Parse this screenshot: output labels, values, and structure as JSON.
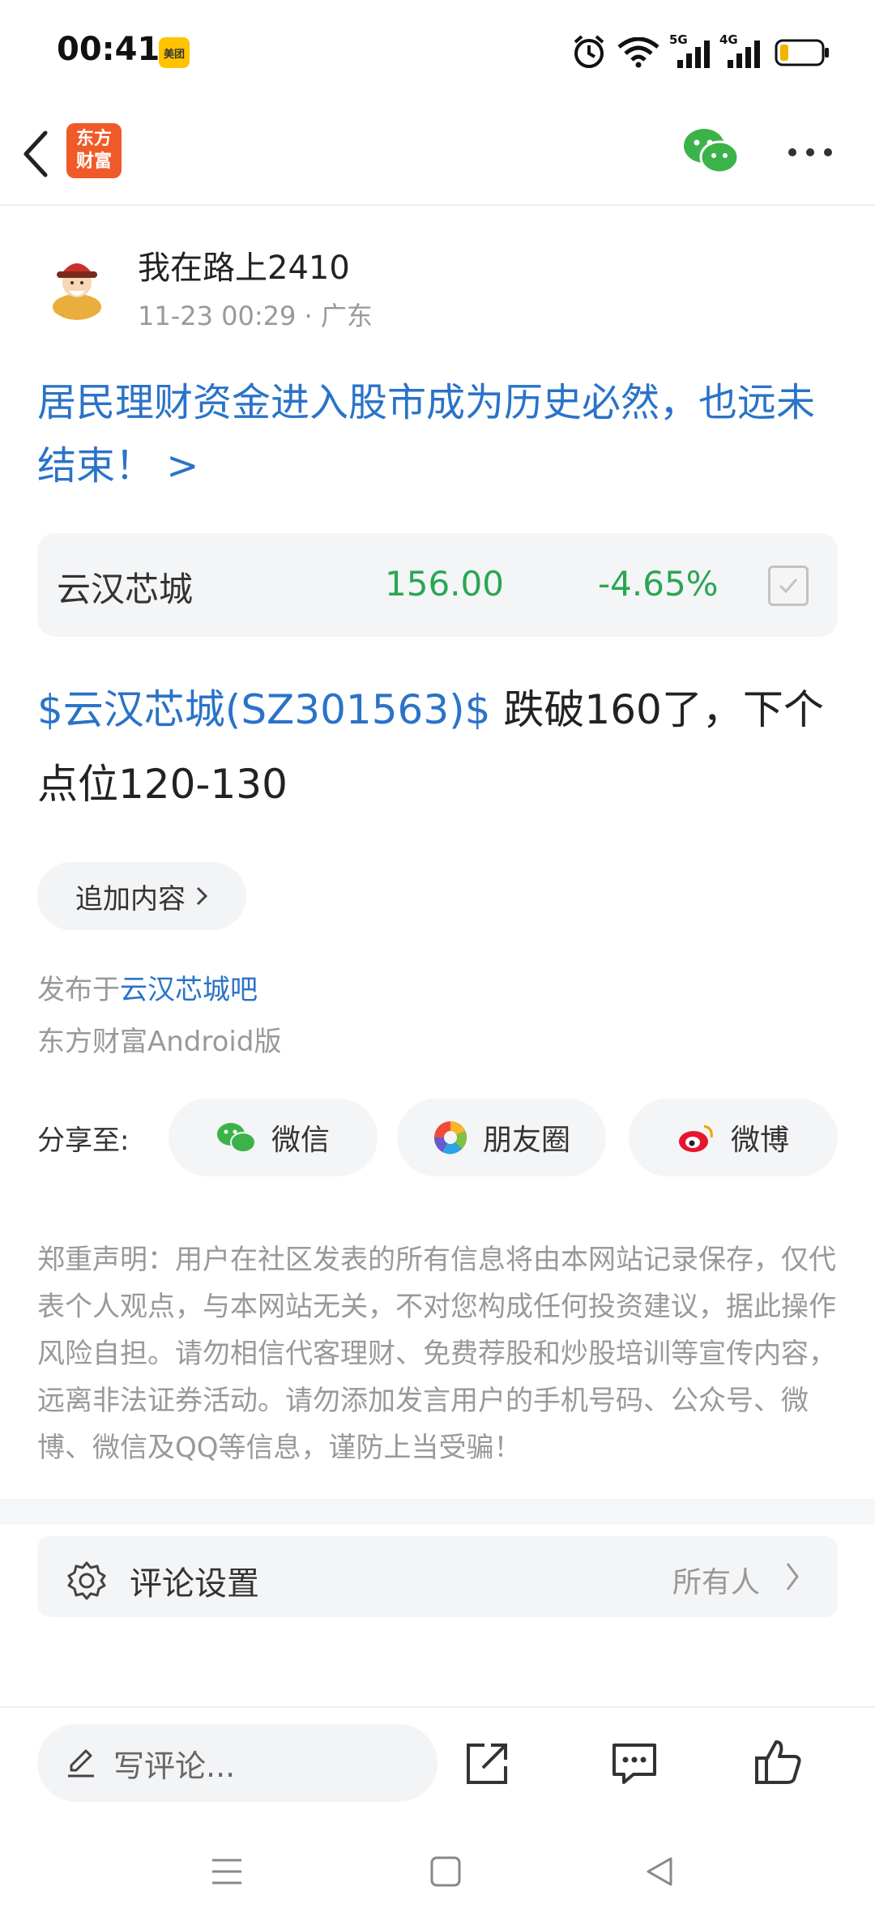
{
  "status_bar": {
    "time": "00:41",
    "app_badge": "美团",
    "net1": "5G",
    "net2": "4G"
  },
  "top_nav": {
    "logo_line1": "东方",
    "logo_line2": "财富"
  },
  "author": {
    "name": "我在路上2410",
    "time": "11-23 00:29",
    "location": "· 广东"
  },
  "post": {
    "title": "居民理财资金进入股市成为历史必然，也远未结束！ >",
    "stock": {
      "name": "云汉芯城",
      "price": "156.00",
      "change": "-4.65%"
    },
    "body_tag": "$云汉芯城(SZ301563)$",
    "body_text": " 跌破160了，下个点位120-130",
    "add_content": "追加内容",
    "published_prefix": "发布于",
    "published_bar": "云汉芯城吧",
    "client": "东方财富Android版"
  },
  "share": {
    "label": "分享至:",
    "wechat": "微信",
    "moments": "朋友圈",
    "weibo": "微博"
  },
  "disclaimer": "郑重声明：用户在社区发表的所有信息将由本网站记录保存，仅代表个人观点，与本网站无关，不对您构成任何投资建议，据此操作风险自担。请勿相信代客理财、免费荐股和炒股培训等宣传内容，远离非法证券活动。请勿添加发言用户的手机号码、公众号、微博、微信及QQ等信息，谨防上当受骗！",
  "comment_settings": {
    "label": "评论设置",
    "value": "所有人"
  },
  "bottom_bar": {
    "placeholder": "写评论..."
  },
  "colors": {
    "link_blue": "#2a73c8",
    "down_green": "#2aa653",
    "brand_orange": "#f05a28"
  }
}
